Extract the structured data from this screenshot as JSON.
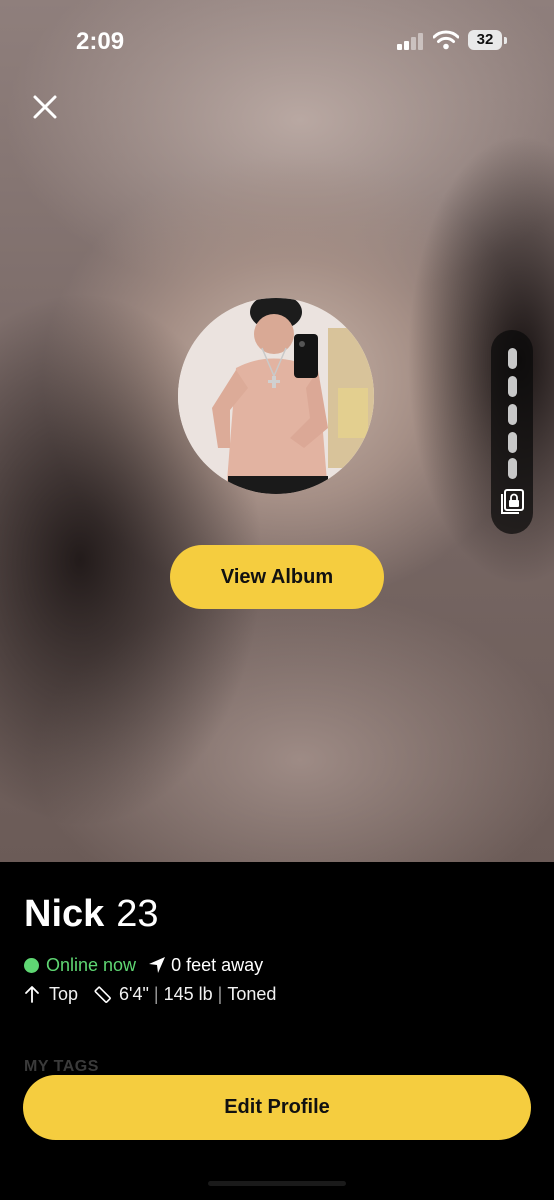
{
  "status_bar": {
    "time": "2:09",
    "battery": "32"
  },
  "header": {
    "close_icon": "close-icon"
  },
  "gallery": {
    "album_button_label": "View Album",
    "photo_slots": 6,
    "album_icon": "locked-album-icon"
  },
  "profile": {
    "name": "Nick",
    "age": "23",
    "online_status": "Online now",
    "distance": "0 feet away",
    "position": "Top",
    "height": "6'4\"",
    "weight": "145 lb",
    "body_type": "Toned"
  },
  "tags": {
    "heading": "MY TAGS"
  },
  "footer": {
    "edit_button_label": "Edit Profile"
  },
  "colors": {
    "accent": "#f5cd3f",
    "online": "#5fd773",
    "background": "#000000"
  }
}
